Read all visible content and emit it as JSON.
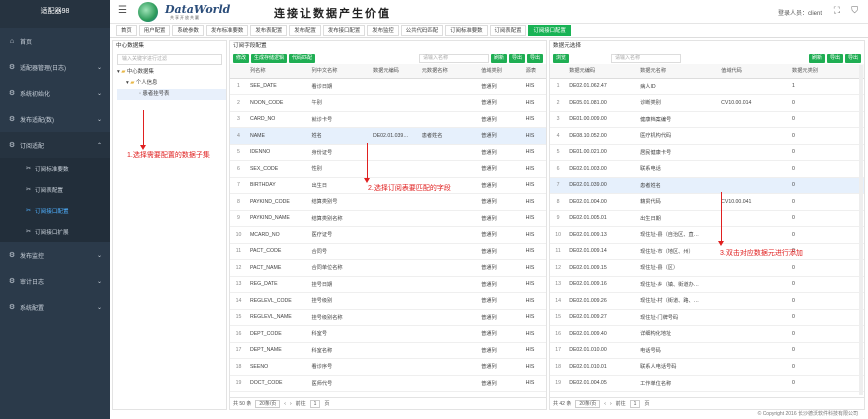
{
  "app": {
    "title": "适配器98"
  },
  "sidebar": {
    "items": [
      {
        "icon": "home-icon",
        "label": "首页"
      },
      {
        "icon": "gear-icon",
        "label": "适配器管理(日志)"
      },
      {
        "icon": "gear-icon",
        "label": "系统初始化"
      },
      {
        "icon": "gear-icon",
        "label": "发布适配(数)"
      },
      {
        "icon": "gear-icon",
        "label": "订阅适配"
      },
      {
        "icon": "gear-icon",
        "label": "发布监控"
      },
      {
        "icon": "gear-icon",
        "label": "审计日志"
      },
      {
        "icon": "gear-icon",
        "label": "系统配置"
      }
    ],
    "subitems": [
      {
        "label": "订阅标准要数"
      },
      {
        "label": "订阅表配置"
      },
      {
        "label": "订阅接口配置"
      },
      {
        "label": "订阅接口扩展"
      }
    ]
  },
  "header": {
    "brand": "DataWorld",
    "brand_sub": "共享开放共赢",
    "slogan": "连接让数据产生价值",
    "user": "登录人员：client"
  },
  "tabs": [
    "首页",
    "用户配置",
    "系统参数",
    "发布标准要数",
    "发布表配置",
    "发布配置",
    "发布接口配置",
    "发布监控",
    "公共代码匹配",
    "订阅标准要数",
    "订阅表配置",
    "订阅接口配置"
  ],
  "panel1": {
    "title": "中心数据集",
    "search_placeholder": "输入关键字进行过滤",
    "tree": [
      "中心数据集",
      "个人信息",
      "患者挂号表"
    ]
  },
  "panel2": {
    "title": "订阅字段配置",
    "buttons": [
      "修改",
      "生成存储逻辑",
      "代码匹配"
    ],
    "search_placeholder": "请输入名称",
    "right_buttons": [
      "刷新",
      "导出",
      "导出"
    ],
    "columns": [
      "",
      "列名称",
      "列中文名称",
      "数据元编码",
      "元数据名称",
      "值域类别",
      "源表"
    ],
    "rows": [
      [
        "1",
        "SEE_DATE",
        "看诊日期",
        "",
        "",
        "普通列",
        "HIS"
      ],
      [
        "2",
        "NOON_CODE",
        "午别",
        "",
        "",
        "普通列",
        "HIS"
      ],
      [
        "3",
        "CARD_NO",
        "就诊卡号",
        "",
        "",
        "普通列",
        "HIS"
      ],
      [
        "4",
        "NAME",
        "姓名",
        "DE02.01.039…",
        "患者姓名",
        "普通列",
        "HIS"
      ],
      [
        "5",
        "IDENNO",
        "身份证号",
        "",
        "",
        "普通列",
        "HIS"
      ],
      [
        "6",
        "SEX_CODE",
        "性别",
        "",
        "",
        "普通列",
        "HIS"
      ],
      [
        "7",
        "BIRTHDAY",
        "出生日",
        "",
        "",
        "普通列",
        "HIS"
      ],
      [
        "8",
        "PAYKIND_CODE",
        "结算类别号",
        "",
        "",
        "普通列",
        "HIS"
      ],
      [
        "9",
        "PAYKIND_NAME",
        "结算类别名称",
        "",
        "",
        "普通列",
        "HIS"
      ],
      [
        "10",
        "MCARD_NO",
        "医疗证号",
        "",
        "",
        "普通列",
        "HIS"
      ],
      [
        "11",
        "PACT_CODE",
        "合同号",
        "",
        "",
        "普通列",
        "HIS"
      ],
      [
        "12",
        "PACT_NAME",
        "合同单位名称",
        "",
        "",
        "普通列",
        "HIS"
      ],
      [
        "13",
        "REG_DATE",
        "挂号日期",
        "",
        "",
        "普通列",
        "HIS"
      ],
      [
        "14",
        "REGLEVL_CODE",
        "挂号级别",
        "",
        "",
        "普通列",
        "HIS"
      ],
      [
        "15",
        "REGLEVL_NAME",
        "挂号级别名称",
        "",
        "",
        "普通列",
        "HIS"
      ],
      [
        "16",
        "DEPT_CODE",
        "科室号",
        "",
        "",
        "普通列",
        "HIS"
      ],
      [
        "17",
        "DEPT_NAME",
        "科室名称",
        "",
        "",
        "普通列",
        "HIS"
      ],
      [
        "18",
        "SEENO",
        "看诊序号",
        "",
        "",
        "普通列",
        "HIS"
      ],
      [
        "19",
        "DOCT_CODE",
        "医师代号",
        "",
        "",
        "普通列",
        "HIS"
      ]
    ],
    "footer": {
      "total": "共 50 条",
      "page_size": "20条/页",
      "prev": "前往",
      "page": "1",
      "suffix": "页"
    }
  },
  "panel3": {
    "title": "数据元选择",
    "buttons": [
      "浏览"
    ],
    "search_placeholder": "请输入名称",
    "right_buttons": [
      "刷新",
      "导出",
      "导出"
    ],
    "columns": [
      "",
      "数据元编码",
      "数据元名称",
      "值域代码",
      "数据元类别"
    ],
    "rows": [
      [
        "1",
        "DE02.01.062.47",
        "病人ID",
        "",
        "1"
      ],
      [
        "2",
        "DE05.01.081.00",
        "诊断类别",
        "CV10.00.014",
        "0"
      ],
      [
        "3",
        "DE01.00.009.00",
        "健康档案编号",
        "",
        "0"
      ],
      [
        "4",
        "DE08.10.052.00",
        "医疗机构代码",
        "",
        "0"
      ],
      [
        "5",
        "DE01.00.021.00",
        "居民健康卡号",
        "",
        "0"
      ],
      [
        "6",
        "DE02.01.003.00",
        "联系电话",
        "",
        "0"
      ],
      [
        "7",
        "DE02.01.039.00",
        "患者姓名",
        "",
        "0"
      ],
      [
        "8",
        "DE02.01.004.00",
        "籍贯代码",
        "CV10.00.041",
        "0"
      ],
      [
        "9",
        "DE02.01.005.01",
        "出生日期",
        "",
        "0"
      ],
      [
        "10",
        "DE02.01.009.13",
        "现住址-县（自治区、直…",
        "",
        "0"
      ],
      [
        "11",
        "DE02.01.009.14",
        "现住址-市（地区、州）",
        "",
        "0"
      ],
      [
        "12",
        "DE02.01.009.15",
        "现住址-县（区）",
        "",
        "0"
      ],
      [
        "13",
        "DE02.01.009.16",
        "现住址-乡（镇、街道办…",
        "",
        "0"
      ],
      [
        "14",
        "DE02.01.009.26",
        "现住址-村（街道、路、…",
        "",
        "0"
      ],
      [
        "15",
        "DE02.01.009.27",
        "现住址-门牌号码",
        "",
        "0"
      ],
      [
        "16",
        "DE02.01.009.40",
        "详细构化地址",
        "",
        "0"
      ],
      [
        "17",
        "DE02.01.010.00",
        "电话号码",
        "",
        "0"
      ],
      [
        "18",
        "DE02.01.010.01",
        "联系人电话号码",
        "",
        "0"
      ],
      [
        "19",
        "DE02.01.004.05",
        "工作单位名称",
        "",
        "0"
      ]
    ],
    "footer": {
      "total": "共 42 条",
      "page_size": "20条/页",
      "prev": "前往",
      "page": "1",
      "suffix": "页"
    }
  },
  "annotations": [
    "1.选择需要配置的数据子集",
    "2.选择订阅表要匹配的字段",
    "3.双击对应数据元进行添加"
  ],
  "copyright": "© Copyright 2016 长沙德沃软件科技有限公司"
}
